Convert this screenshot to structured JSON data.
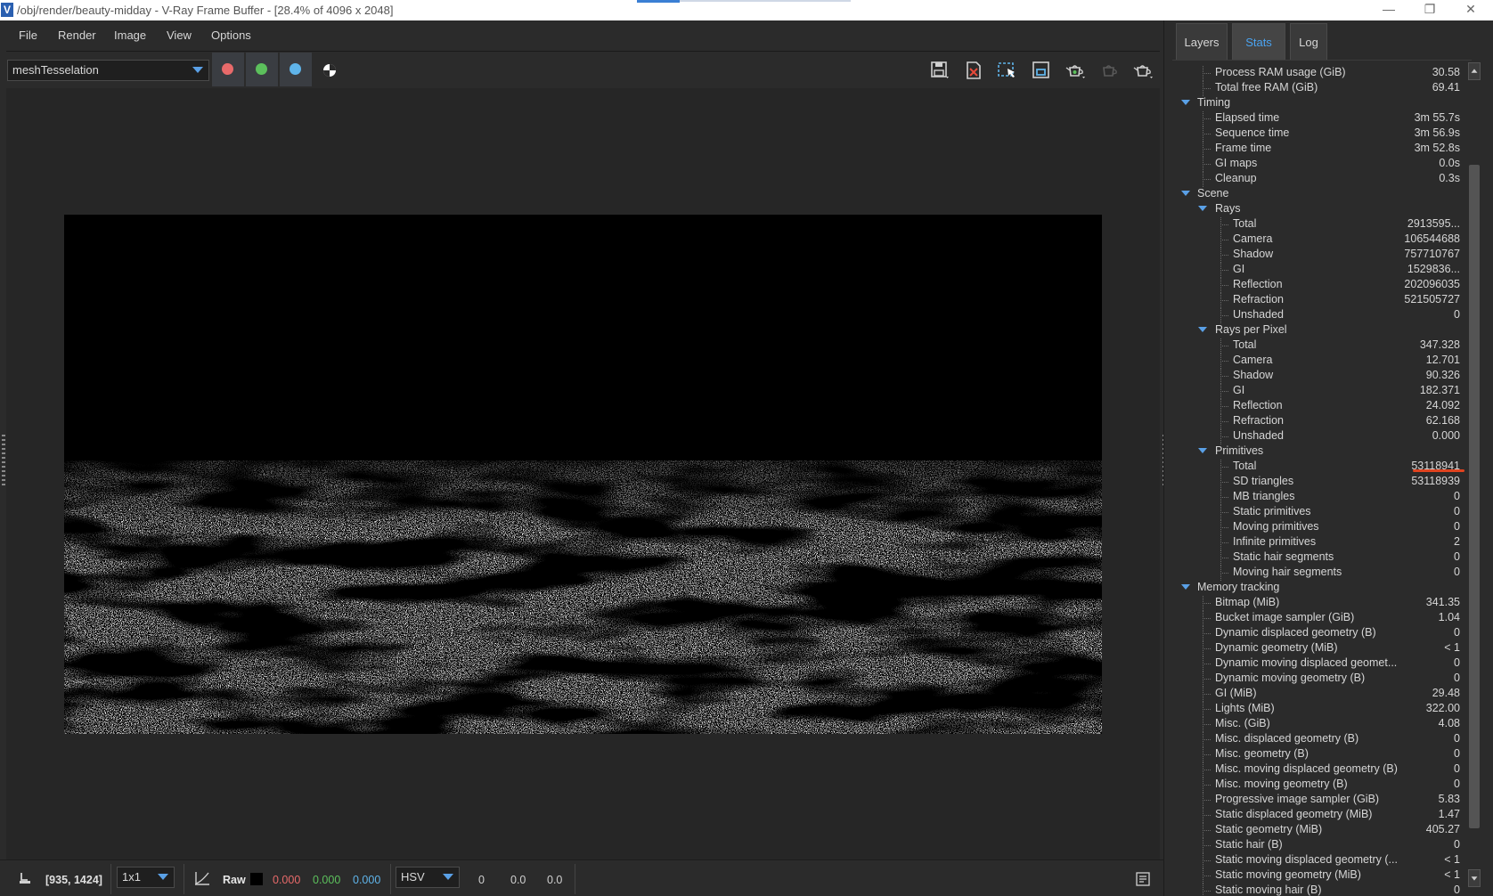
{
  "window": {
    "title": "/obj/render/beauty-midday - V-Ray Frame Buffer - [28.4% of 4096 x 2048]",
    "app_icon_letter": "V"
  },
  "menu": [
    "File",
    "Render",
    "Image",
    "View",
    "Options"
  ],
  "toolbar": {
    "channel_selected": "meshTesselation",
    "channel_colors": {
      "red": "#e86a6a",
      "green": "#5cc05c",
      "blue": "#5fb4ea"
    }
  },
  "statusbar": {
    "coords": "[935, 1424]",
    "zoom": "1x1",
    "mode": "Raw",
    "r": "0.000",
    "g": "0.000",
    "b": "0.000",
    "colorspace": "HSV",
    "h": "0",
    "s": "0.0",
    "v": "0.0"
  },
  "tabs": [
    {
      "label": "Layers",
      "active": false
    },
    {
      "label": "Stats",
      "active": true
    },
    {
      "label": "Log",
      "active": false
    }
  ],
  "stats": [
    {
      "level": 2,
      "label": "Process RAM usage (GiB)",
      "value": "30.58"
    },
    {
      "level": 2,
      "label": "Total free RAM (GiB)",
      "value": "69.41"
    },
    {
      "level": 1,
      "label": "Timing",
      "value": "",
      "expanded": true
    },
    {
      "level": 2,
      "label": "Elapsed time",
      "value": "3m 55.7s"
    },
    {
      "level": 2,
      "label": "Sequence time",
      "value": "3m 56.9s"
    },
    {
      "level": 2,
      "label": "Frame time",
      "value": "3m 52.8s"
    },
    {
      "level": 2,
      "label": "GI maps",
      "value": "0.0s"
    },
    {
      "level": 2,
      "label": "Cleanup",
      "value": "0.3s"
    },
    {
      "level": 1,
      "label": "Scene",
      "value": "",
      "expanded": true
    },
    {
      "level": 2,
      "label": "Rays",
      "value": "",
      "expanded": true
    },
    {
      "level": 3,
      "label": "Total",
      "value": "2913595..."
    },
    {
      "level": 3,
      "label": "Camera",
      "value": "106544688"
    },
    {
      "level": 3,
      "label": "Shadow",
      "value": "757710767"
    },
    {
      "level": 3,
      "label": "GI",
      "value": "1529836..."
    },
    {
      "level": 3,
      "label": "Reflection",
      "value": "202096035"
    },
    {
      "level": 3,
      "label": "Refraction",
      "value": "521505727"
    },
    {
      "level": 3,
      "label": "Unshaded",
      "value": "0"
    },
    {
      "level": 2,
      "label": "Rays per Pixel",
      "value": "",
      "expanded": true
    },
    {
      "level": 3,
      "label": "Total",
      "value": "347.328"
    },
    {
      "level": 3,
      "label": "Camera",
      "value": "12.701"
    },
    {
      "level": 3,
      "label": "Shadow",
      "value": "90.326"
    },
    {
      "level": 3,
      "label": "GI",
      "value": "182.371"
    },
    {
      "level": 3,
      "label": "Reflection",
      "value": "24.092"
    },
    {
      "level": 3,
      "label": "Refraction",
      "value": "62.168"
    },
    {
      "level": 3,
      "label": "Unshaded",
      "value": "0.000"
    },
    {
      "level": 2,
      "label": "Primitives",
      "value": "",
      "expanded": true
    },
    {
      "level": 3,
      "label": "Total",
      "value": "53118941",
      "highlight": true
    },
    {
      "level": 3,
      "label": "SD triangles",
      "value": "53118939"
    },
    {
      "level": 3,
      "label": "MB triangles",
      "value": "0"
    },
    {
      "level": 3,
      "label": "Static primitives",
      "value": "0"
    },
    {
      "level": 3,
      "label": "Moving primitives",
      "value": "0"
    },
    {
      "level": 3,
      "label": "Infinite primitives",
      "value": "2"
    },
    {
      "level": 3,
      "label": "Static hair segments",
      "value": "0"
    },
    {
      "level": 3,
      "label": "Moving hair segments",
      "value": "0"
    },
    {
      "level": 1,
      "label": "Memory tracking",
      "value": "",
      "expanded": true
    },
    {
      "level": 2,
      "label": "Bitmap (MiB)",
      "value": "341.35"
    },
    {
      "level": 2,
      "label": "Bucket image sampler (GiB)",
      "value": "1.04"
    },
    {
      "level": 2,
      "label": "Dynamic displaced geometry (B)",
      "value": "0"
    },
    {
      "level": 2,
      "label": "Dynamic geometry (MiB)",
      "value": "< 1"
    },
    {
      "level": 2,
      "label": "Dynamic moving displaced geomet...",
      "value": "0"
    },
    {
      "level": 2,
      "label": "Dynamic moving geometry (B)",
      "value": "0"
    },
    {
      "level": 2,
      "label": "GI (MiB)",
      "value": "29.48"
    },
    {
      "level": 2,
      "label": "Lights (MiB)",
      "value": "322.00"
    },
    {
      "level": 2,
      "label": "Misc. (GiB)",
      "value": "4.08"
    },
    {
      "level": 2,
      "label": "Misc. displaced geometry (B)",
      "value": "0"
    },
    {
      "level": 2,
      "label": "Misc. geometry (B)",
      "value": "0"
    },
    {
      "level": 2,
      "label": "Misc. moving displaced geometry (B)",
      "value": "0"
    },
    {
      "level": 2,
      "label": "Misc. moving geometry (B)",
      "value": "0"
    },
    {
      "level": 2,
      "label": "Progressive image sampler (GiB)",
      "value": "5.83"
    },
    {
      "level": 2,
      "label": "Static displaced geometry (MiB)",
      "value": "1.47"
    },
    {
      "level": 2,
      "label": "Static geometry (MiB)",
      "value": "405.27"
    },
    {
      "level": 2,
      "label": "Static hair (B)",
      "value": "0"
    },
    {
      "level": 2,
      "label": "Static moving displaced geometry (...",
      "value": "< 1"
    },
    {
      "level": 2,
      "label": "Static moving geometry (MiB)",
      "value": "< 1"
    },
    {
      "level": 2,
      "label": "Static moving hair (B)",
      "value": "0"
    }
  ]
}
